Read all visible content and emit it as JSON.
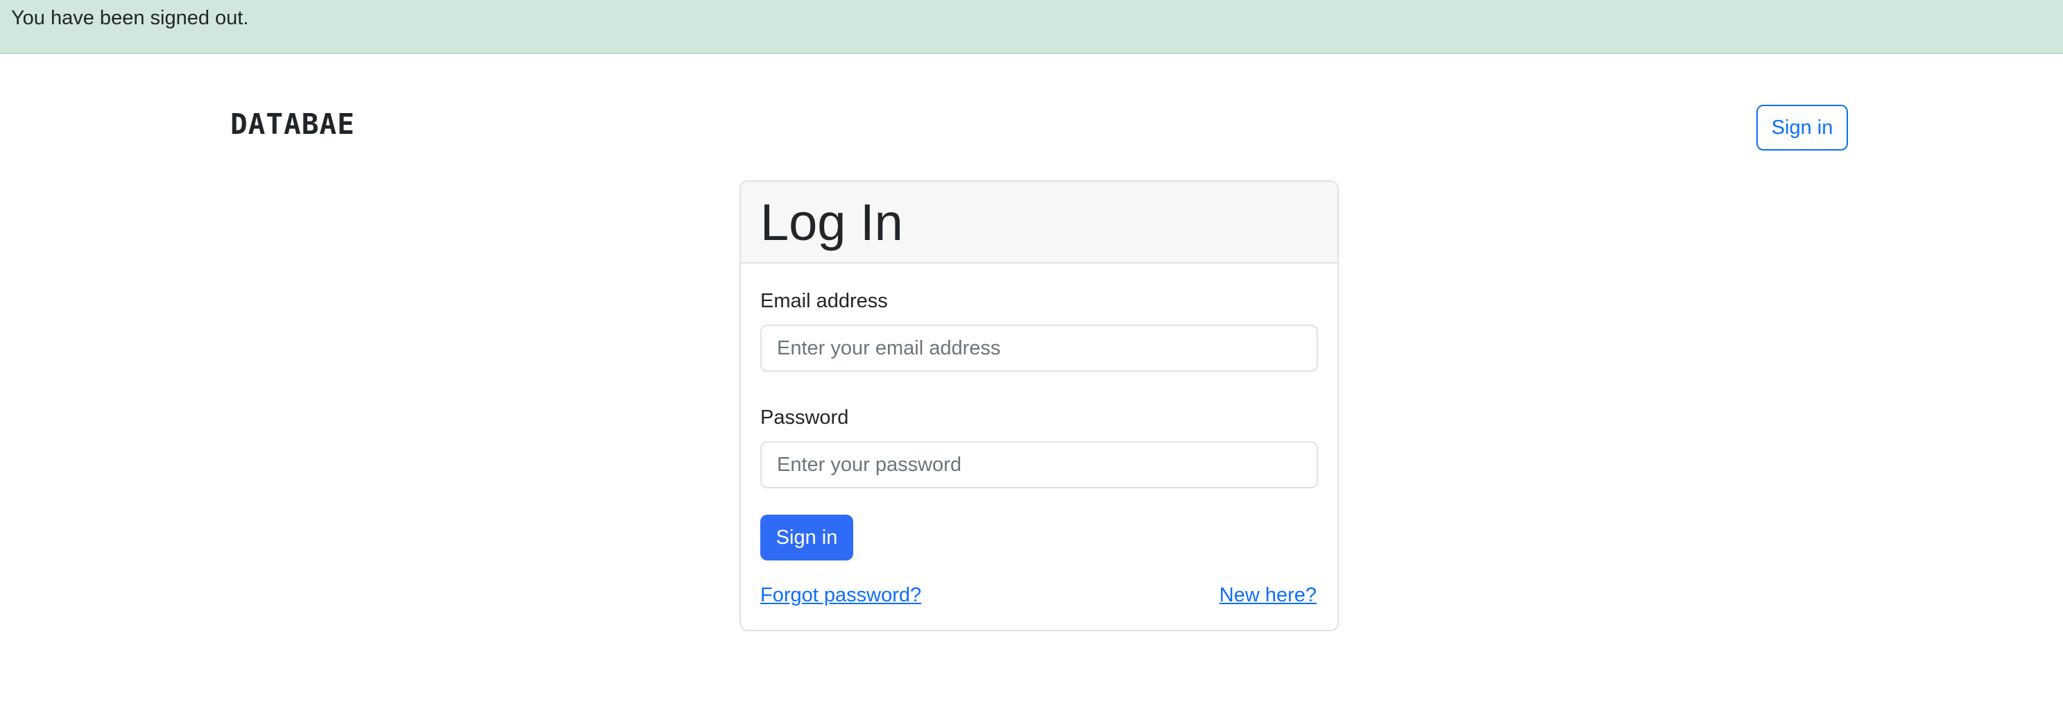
{
  "flash": {
    "message": "You have been signed out."
  },
  "header": {
    "brand": "DATABAE",
    "signin_label": "Sign in"
  },
  "login_card": {
    "title": "Log In",
    "email": {
      "label": "Email address",
      "placeholder": "Enter your email address",
      "value": ""
    },
    "password": {
      "label": "Password",
      "placeholder": "Enter your password",
      "value": ""
    },
    "submit_label": "Sign in",
    "forgot_link": "Forgot password?",
    "signup_link": "New here?"
  },
  "colors": {
    "primary": "#0d6efd",
    "flash_bg": "#d1e7dd",
    "card_header_bg": "#f7f7f7"
  }
}
